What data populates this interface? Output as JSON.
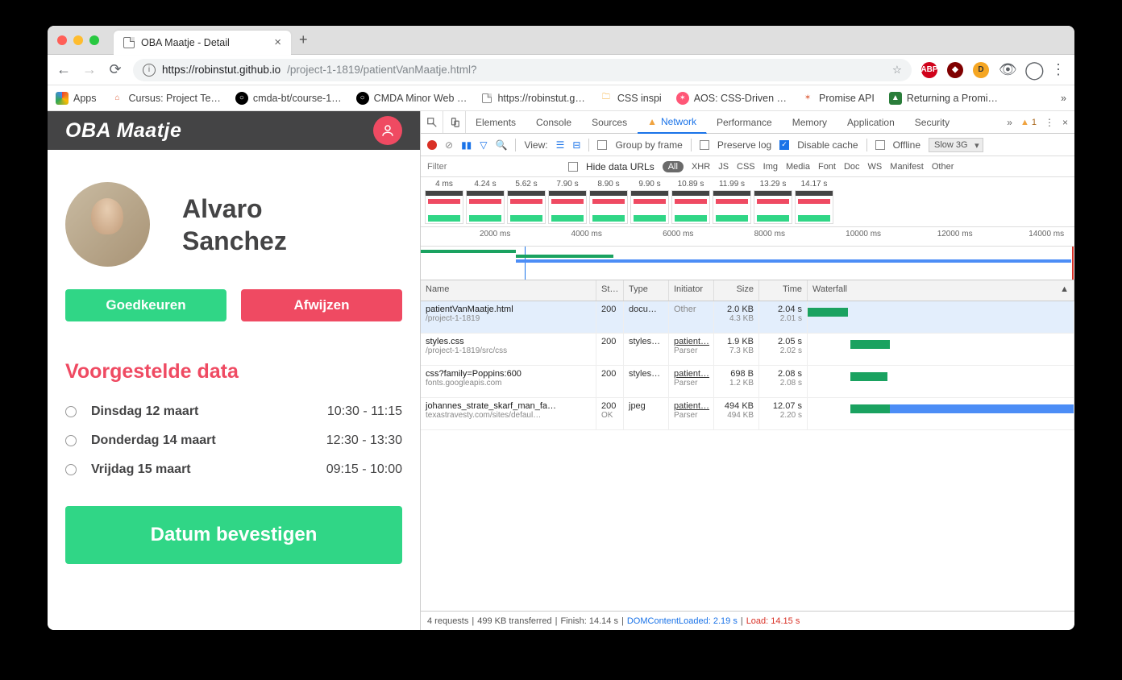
{
  "browser": {
    "tab_title": "OBA Maatje - Detail",
    "url_host": "https://robinstut.github.io",
    "url_path": "/project-1-1819/patientVanMaatje.html?"
  },
  "bookmarks": [
    "Apps",
    "Cursus: Project Te…",
    "cmda-bt/course-1…",
    "CMDA Minor Web …",
    "https://robinstut.g…",
    "CSS inspi",
    "AOS: CSS-Driven …",
    "Promise API",
    "Returning a Promi…"
  ],
  "app": {
    "title": "OBA Maatje",
    "name_line1": "Alvaro",
    "name_line2": "Sanchez",
    "approve": "Goedkeuren",
    "reject": "Afwijzen",
    "section": "Voorgestelde data",
    "dates": [
      {
        "day": "Dinsdag 12 maart",
        "time": "10:30 - 11:15"
      },
      {
        "day": "Donderdag 14 maart",
        "time": "12:30 - 13:30"
      },
      {
        "day": "Vrijdag 15 maart",
        "time": "09:15 - 10:00"
      }
    ],
    "confirm": "Datum bevestigen"
  },
  "devtools": {
    "tabs": [
      "Elements",
      "Console",
      "Sources",
      "Network",
      "Performance",
      "Memory",
      "Application",
      "Security"
    ],
    "warn_count": "1",
    "view_label": "View:",
    "group": "Group by frame",
    "preserve": "Preserve log",
    "disable": "Disable cache",
    "offline": "Offline",
    "throttle": "Slow 3G",
    "filter_placeholder": "Filter",
    "hide_urls": "Hide data URLs",
    "types": [
      "All",
      "XHR",
      "JS",
      "CSS",
      "Img",
      "Media",
      "Font",
      "Doc",
      "WS",
      "Manifest",
      "Other"
    ],
    "frames": [
      "4 ms",
      "4.24 s",
      "5.62 s",
      "7.90 s",
      "8.90 s",
      "9.90 s",
      "10.89 s",
      "11.99 s",
      "13.29 s",
      "14.17 s"
    ],
    "ticks": [
      "2000 ms",
      "4000 ms",
      "6000 ms",
      "8000 ms",
      "10000 ms",
      "12000 ms",
      "14000 ms"
    ],
    "cols": [
      "Name",
      "St…",
      "Type",
      "Initiator",
      "Size",
      "Time",
      "Waterfall"
    ],
    "rows": [
      {
        "name": "patientVanMaatje.html",
        "sub": "/project-1-1819",
        "st": "200",
        "type": "docu…",
        "init": "Other",
        "initsub": "",
        "s1": "2.0 KB",
        "s2": "4.3 KB",
        "t1": "2.04 s",
        "t2": "2.01 s"
      },
      {
        "name": "styles.css",
        "sub": "/project-1-1819/src/css",
        "st": "200",
        "type": "styles…",
        "init": "patient…",
        "initsub": "Parser",
        "s1": "1.9 KB",
        "s2": "7.3 KB",
        "t1": "2.05 s",
        "t2": "2.02 s"
      },
      {
        "name": "css?family=Poppins:600",
        "sub": "fonts.googleapis.com",
        "st": "200",
        "type": "styles…",
        "init": "patient…",
        "initsub": "Parser",
        "s1": "698 B",
        "s2": "1.2 KB",
        "t1": "2.08 s",
        "t2": "2.08 s"
      },
      {
        "name": "johannes_strate_skarf_man_fa…",
        "sub": "texastravesty.com/sites/defaul…",
        "st": "200",
        "stsub": "OK",
        "type": "jpeg",
        "init": "patient…",
        "initsub": "Parser",
        "s1": "494 KB",
        "s2": "494 KB",
        "t1": "12.07 s",
        "t2": "2.20 s"
      }
    ],
    "footer": {
      "req": "4 requests",
      "size": "499 KB transferred",
      "finish": "Finish: 14.14 s",
      "dom": "DOMContentLoaded: 2.19 s",
      "load": "Load: 14.15 s"
    }
  }
}
